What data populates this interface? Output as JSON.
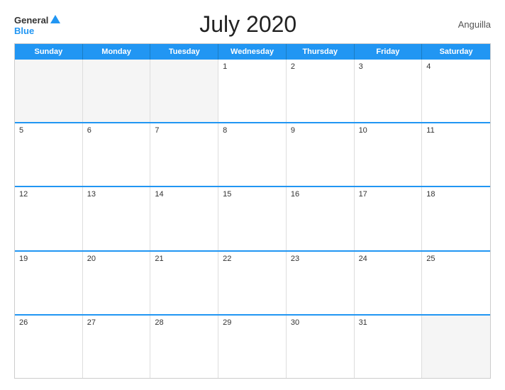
{
  "header": {
    "title": "July 2020",
    "country": "Anguilla",
    "logo": {
      "general": "General",
      "blue": "Blue"
    }
  },
  "days_header": [
    "Sunday",
    "Monday",
    "Tuesday",
    "Wednesday",
    "Thursday",
    "Friday",
    "Saturday"
  ],
  "weeks": [
    [
      {
        "day": "",
        "empty": true
      },
      {
        "day": "",
        "empty": true
      },
      {
        "day": "",
        "empty": true
      },
      {
        "day": "1",
        "empty": false
      },
      {
        "day": "2",
        "empty": false
      },
      {
        "day": "3",
        "empty": false
      },
      {
        "day": "4",
        "empty": false
      }
    ],
    [
      {
        "day": "5",
        "empty": false
      },
      {
        "day": "6",
        "empty": false
      },
      {
        "day": "7",
        "empty": false
      },
      {
        "day": "8",
        "empty": false
      },
      {
        "day": "9",
        "empty": false
      },
      {
        "day": "10",
        "empty": false
      },
      {
        "day": "11",
        "empty": false
      }
    ],
    [
      {
        "day": "12",
        "empty": false
      },
      {
        "day": "13",
        "empty": false
      },
      {
        "day": "14",
        "empty": false
      },
      {
        "day": "15",
        "empty": false
      },
      {
        "day": "16",
        "empty": false
      },
      {
        "day": "17",
        "empty": false
      },
      {
        "day": "18",
        "empty": false
      }
    ],
    [
      {
        "day": "19",
        "empty": false
      },
      {
        "day": "20",
        "empty": false
      },
      {
        "day": "21",
        "empty": false
      },
      {
        "day": "22",
        "empty": false
      },
      {
        "day": "23",
        "empty": false
      },
      {
        "day": "24",
        "empty": false
      },
      {
        "day": "25",
        "empty": false
      }
    ],
    [
      {
        "day": "26",
        "empty": false
      },
      {
        "day": "27",
        "empty": false
      },
      {
        "day": "28",
        "empty": false
      },
      {
        "day": "29",
        "empty": false
      },
      {
        "day": "30",
        "empty": false
      },
      {
        "day": "31",
        "empty": false
      },
      {
        "day": "",
        "empty": true
      }
    ]
  ]
}
